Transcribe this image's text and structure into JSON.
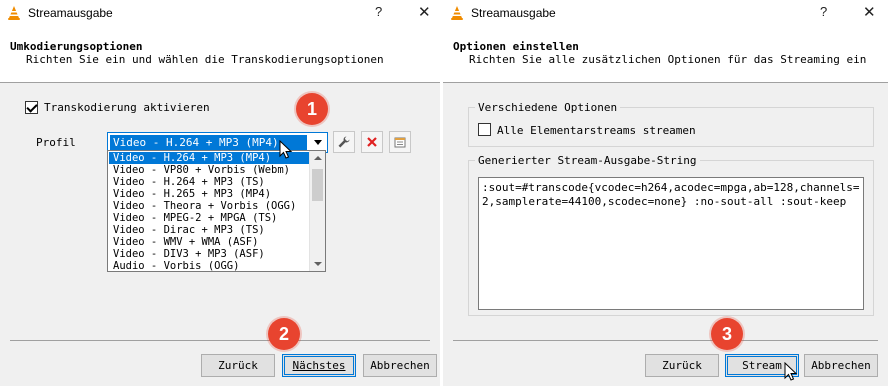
{
  "left_window": {
    "title": "Streamausgabe",
    "help": "?",
    "close": "✕",
    "header_title": "Umkodierungsoptionen",
    "header_subtitle": "Richten Sie ein und wählen die Transkodierungsoptionen",
    "transcode_checkbox_label": "Transkodierung aktivieren",
    "transcode_checked": true,
    "profile_label": "Profil",
    "profile_selected": "Video - H.264 + MP3 (MP4)",
    "profile_options": [
      "Video - H.264 + MP3 (MP4)",
      "Video - VP80 + Vorbis (Webm)",
      "Video - H.264 + MP3 (TS)",
      "Video - H.265 + MP3 (MP4)",
      "Video - Theora + Vorbis (OGG)",
      "Video - MPEG-2 + MPGA (TS)",
      "Video - Dirac + MP3 (TS)",
      "Video - WMV + WMA (ASF)",
      "Video - DIV3 + MP3 (ASF)",
      "Audio - Vorbis (OGG)"
    ],
    "toolbar_icons": [
      "wrench-icon",
      "delete-icon",
      "new-profile-icon"
    ],
    "back_button": "Zurück",
    "next_button": "Nächstes",
    "cancel_button": "Abbrechen",
    "badge_1": "1",
    "badge_2": "2"
  },
  "right_window": {
    "title": "Streamausgabe",
    "help": "?",
    "close": "✕",
    "header_title": "Optionen einstellen",
    "header_subtitle": "Richten Sie alle zusätzlichen Optionen für das Streaming ein",
    "group_misc_label": "Verschiedene Optionen",
    "all_es_checkbox_label": "Alle Elementarstreams streamen",
    "all_es_checked": false,
    "group_string_label": "Generierter Stream-Ausgabe-String",
    "generated_string": ":sout=#transcode{vcodec=h264,acodec=mpga,ab=128,channels=2,samplerate=44100,scodec=none} :no-sout-all :sout-keep",
    "back_button": "Zurück",
    "stream_button": "Stream",
    "cancel_button": "Abbrechen",
    "badge_3": "3"
  },
  "colors": {
    "accent": "#0078d7",
    "badge": "#e8442f",
    "vlc_orange": "#f08c00"
  }
}
